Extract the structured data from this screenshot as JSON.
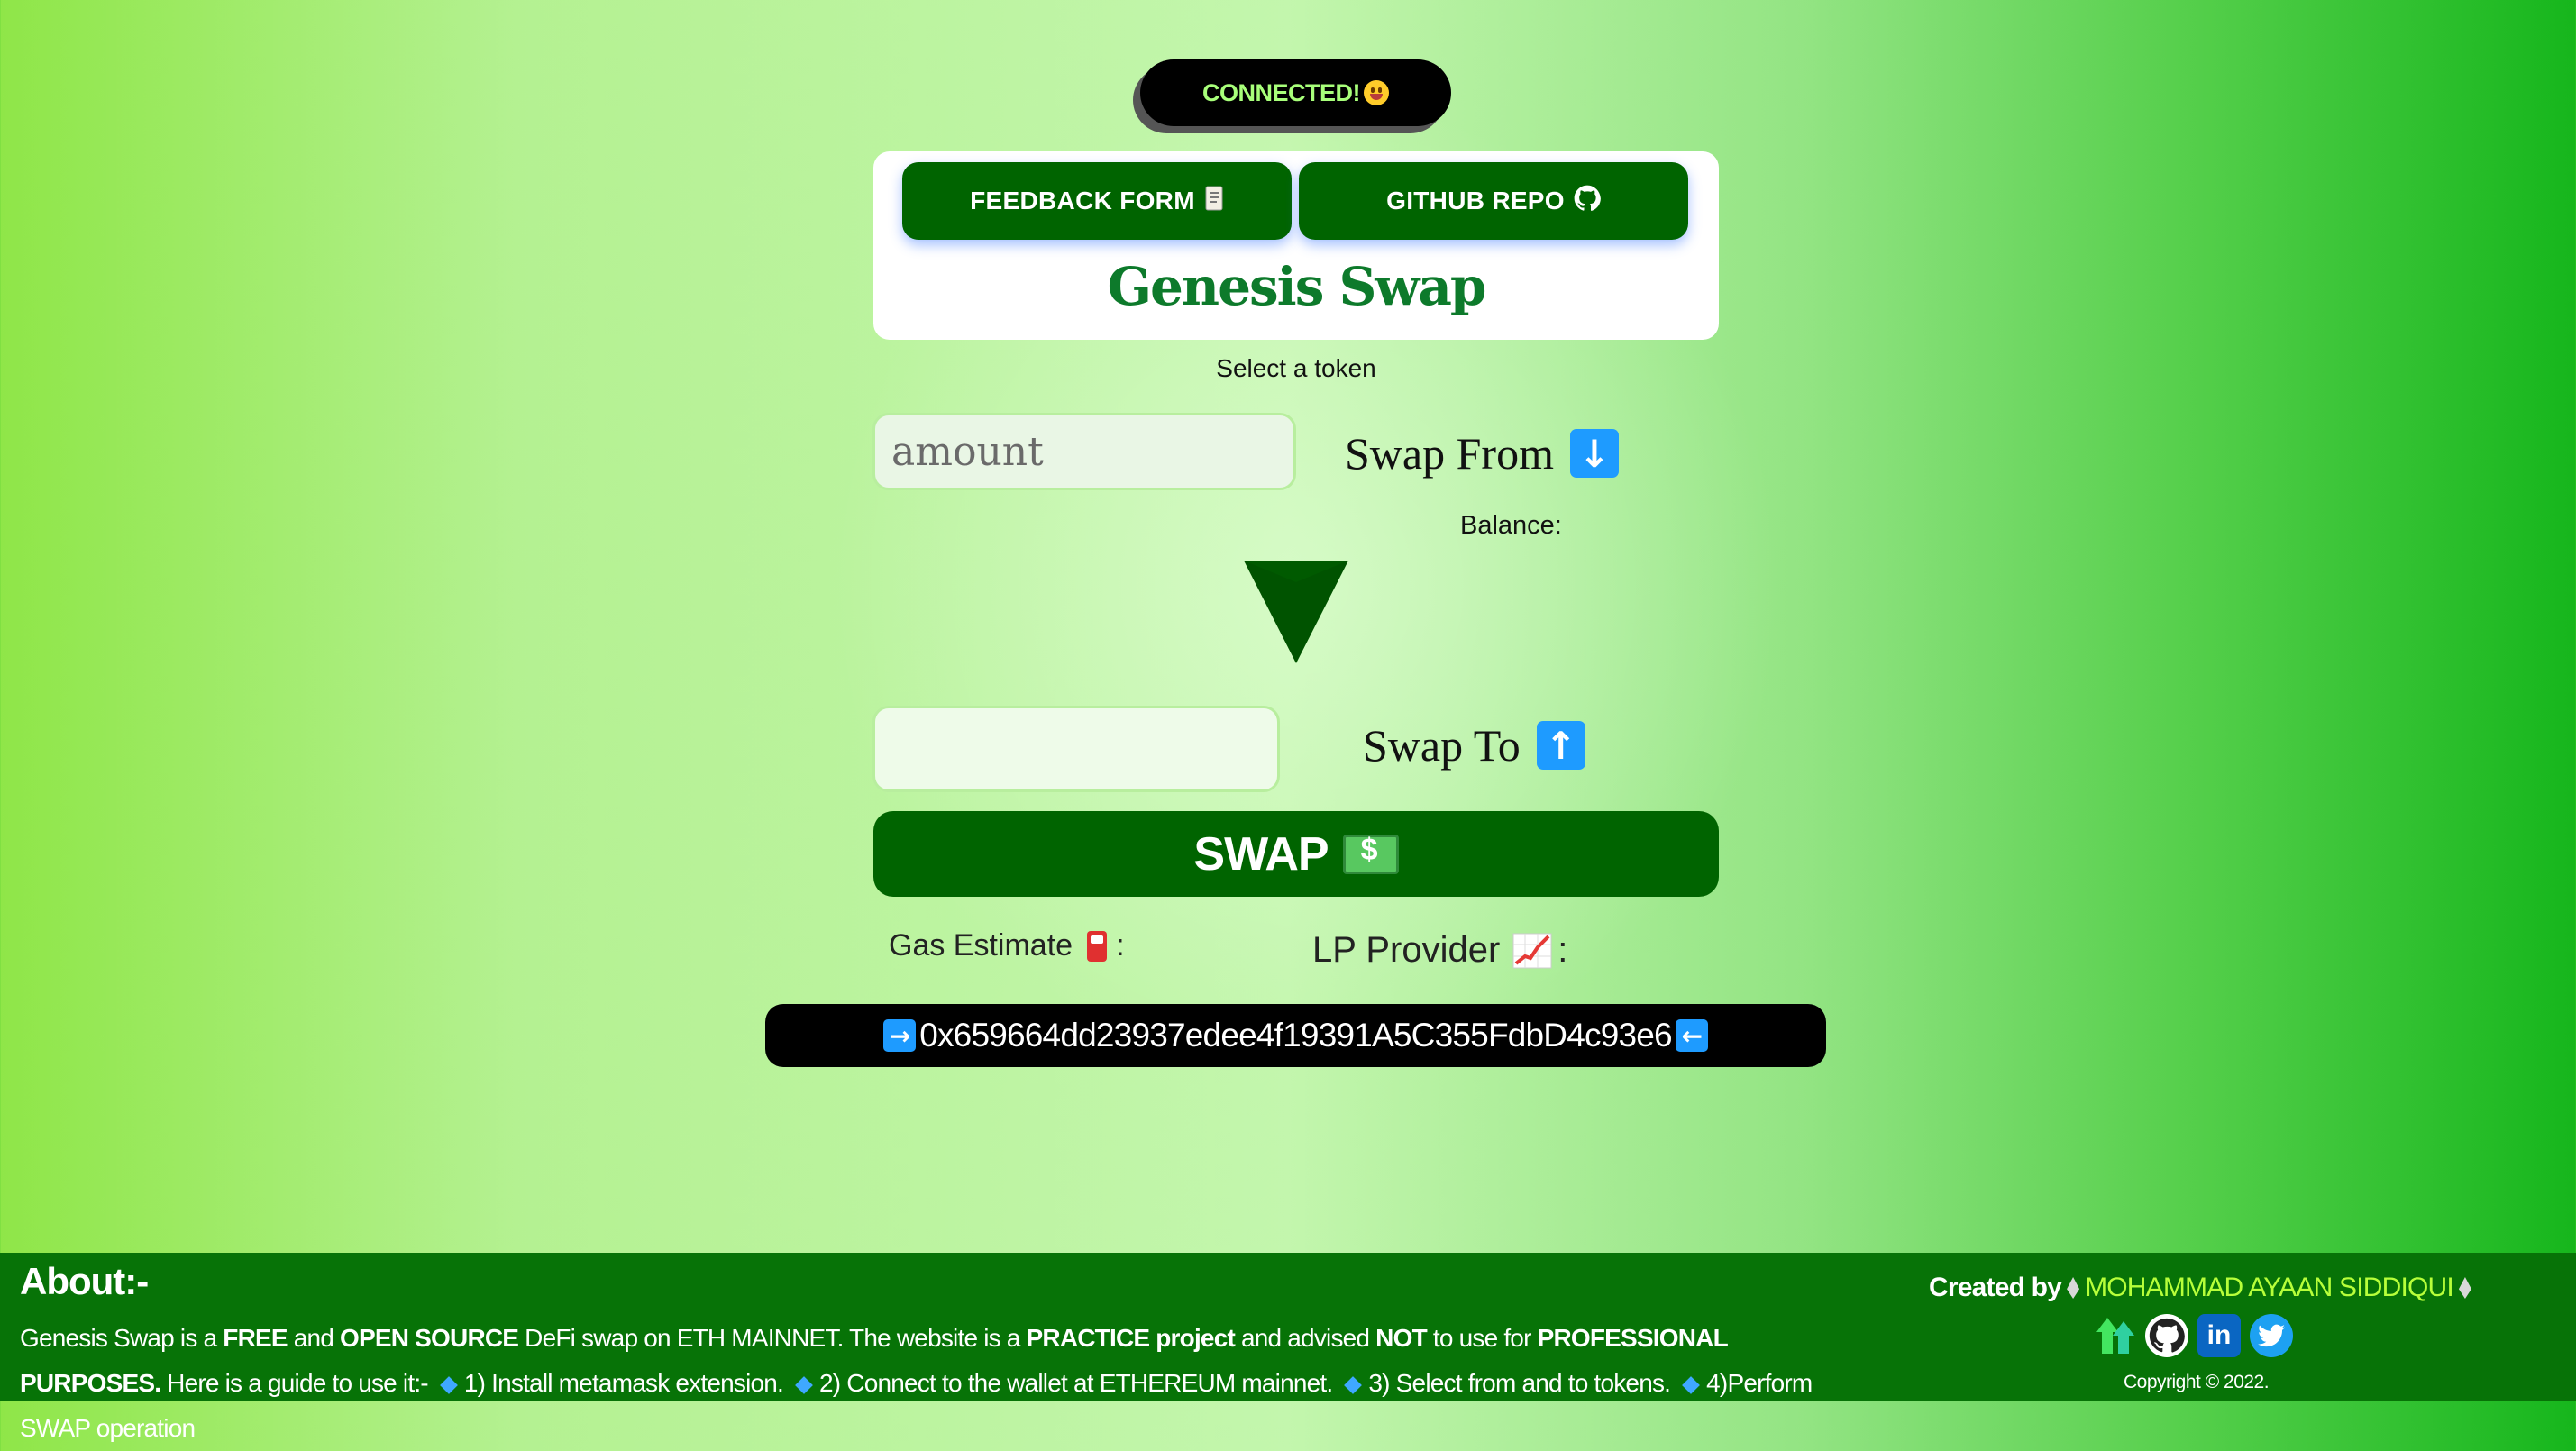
{
  "status": {
    "connected_label": "CONNECTED!"
  },
  "header": {
    "feedback_label": "FEEDBACK FORM",
    "github_label": "GITHUB REPO",
    "title": "Genesis Swap"
  },
  "swap": {
    "select_token": "Select a token",
    "amount_placeholder": "amount",
    "from_label": "Swap From",
    "balance_label": "Balance:",
    "to_label": "Swap To",
    "swap_button": "SWAP",
    "gas_label": "Gas Estimate",
    "gas_sep": ":",
    "lp_label": "LP Provider",
    "lp_sep": ":",
    "address": "0x659664dd23937edee4f19391A5C355FdbD4c93e6"
  },
  "footer": {
    "about_title": "About:-",
    "about_parts": {
      "p1": "Genesis Swap is a ",
      "b1": "FREE",
      "p2": " and ",
      "b2": "OPEN SOURCE",
      "p3": " DeFi swap on ETH MAINNET. The website is a ",
      "b3": "PRACTICE project",
      "p4": " and advised ",
      "b4": "NOT",
      "p5": " to use for ",
      "b5": "PROFESSIONAL PURPOSES.",
      "p6": " Here is a guide to use it:-",
      "s1": "1) Install metamask extension.",
      "s2": "2) Connect to the wallet at ETHEREUM mainnet.",
      "s3": "3) Select from and to tokens.",
      "s4": "4)Perform SWAP operation"
    },
    "created_by": "Created by",
    "author": "MOHAMMAD AYAAN SIDDIQUI",
    "copyright": "Copyright © 2022."
  },
  "colors": {
    "brand_green": "#006400",
    "title_green": "#0d7a2b",
    "footer_green": "#077307",
    "author_color": "#b7ff3a",
    "arrow_blue": "#1e9bff"
  },
  "icons": [
    "smiley-icon",
    "scroll-icon",
    "github-icon",
    "down-arrow-icon",
    "chevron-down-icon",
    "up-arrow-icon",
    "money-icon",
    "fuel-pump-icon",
    "chart-up-icon",
    "right-arrow-icon",
    "left-arrow-icon",
    "ethereum-icon",
    "linktree-icon",
    "linkedin-icon",
    "twitter-icon"
  ]
}
